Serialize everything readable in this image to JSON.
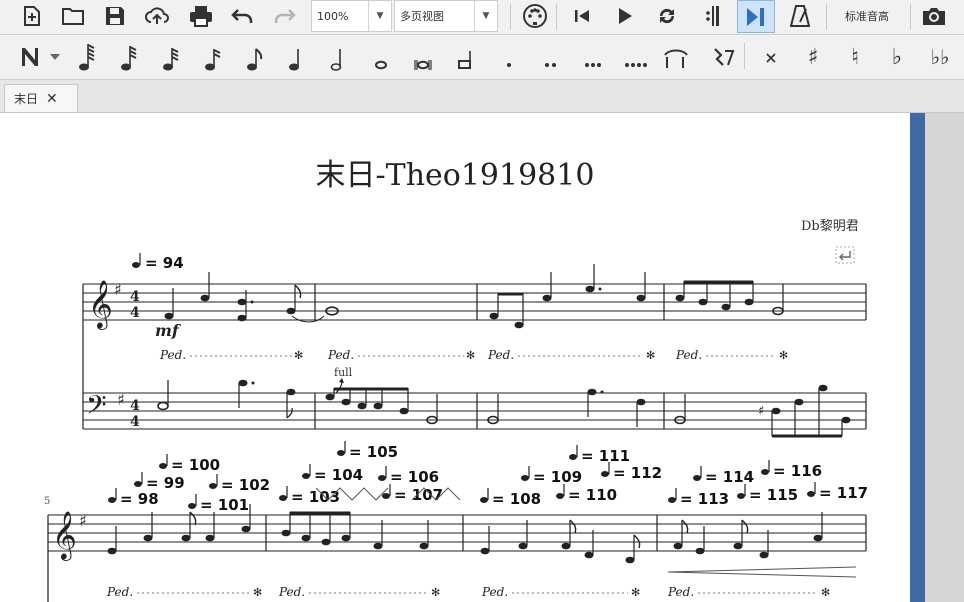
{
  "toolbar": {
    "zoom_value": "100%",
    "view_mode": "多页视图",
    "concert_pitch_label": "标准音高"
  },
  "tabs": [
    {
      "label": "末日"
    }
  ],
  "score": {
    "title": "末日-Theo1919810",
    "composer": "Db黎明君",
    "tempo_initial": "= 94",
    "dynamic": "mf",
    "bend_label": "full",
    "pedal_text": "Ped.",
    "pedal_release": "✻",
    "time_signature": "4/4",
    "measure_number_2": "5",
    "tempo_marks": [
      "= 98",
      "= 99",
      "= 100",
      "= 101",
      "= 102",
      "= 103",
      "= 104",
      "= 105",
      "= 106",
      "= 107",
      "= 108",
      "= 109",
      "= 110",
      "= 111",
      "= 112",
      "= 113",
      "= 114",
      "= 115",
      "= 116",
      "= 117"
    ]
  },
  "colors": {
    "toolbar_bg": "#f1f1f1",
    "active_button": "#cfe3f8",
    "page_bg": "#ffffff",
    "scroll_bar": "#3f6aa3",
    "accent_blue": "#2f6fc4"
  }
}
